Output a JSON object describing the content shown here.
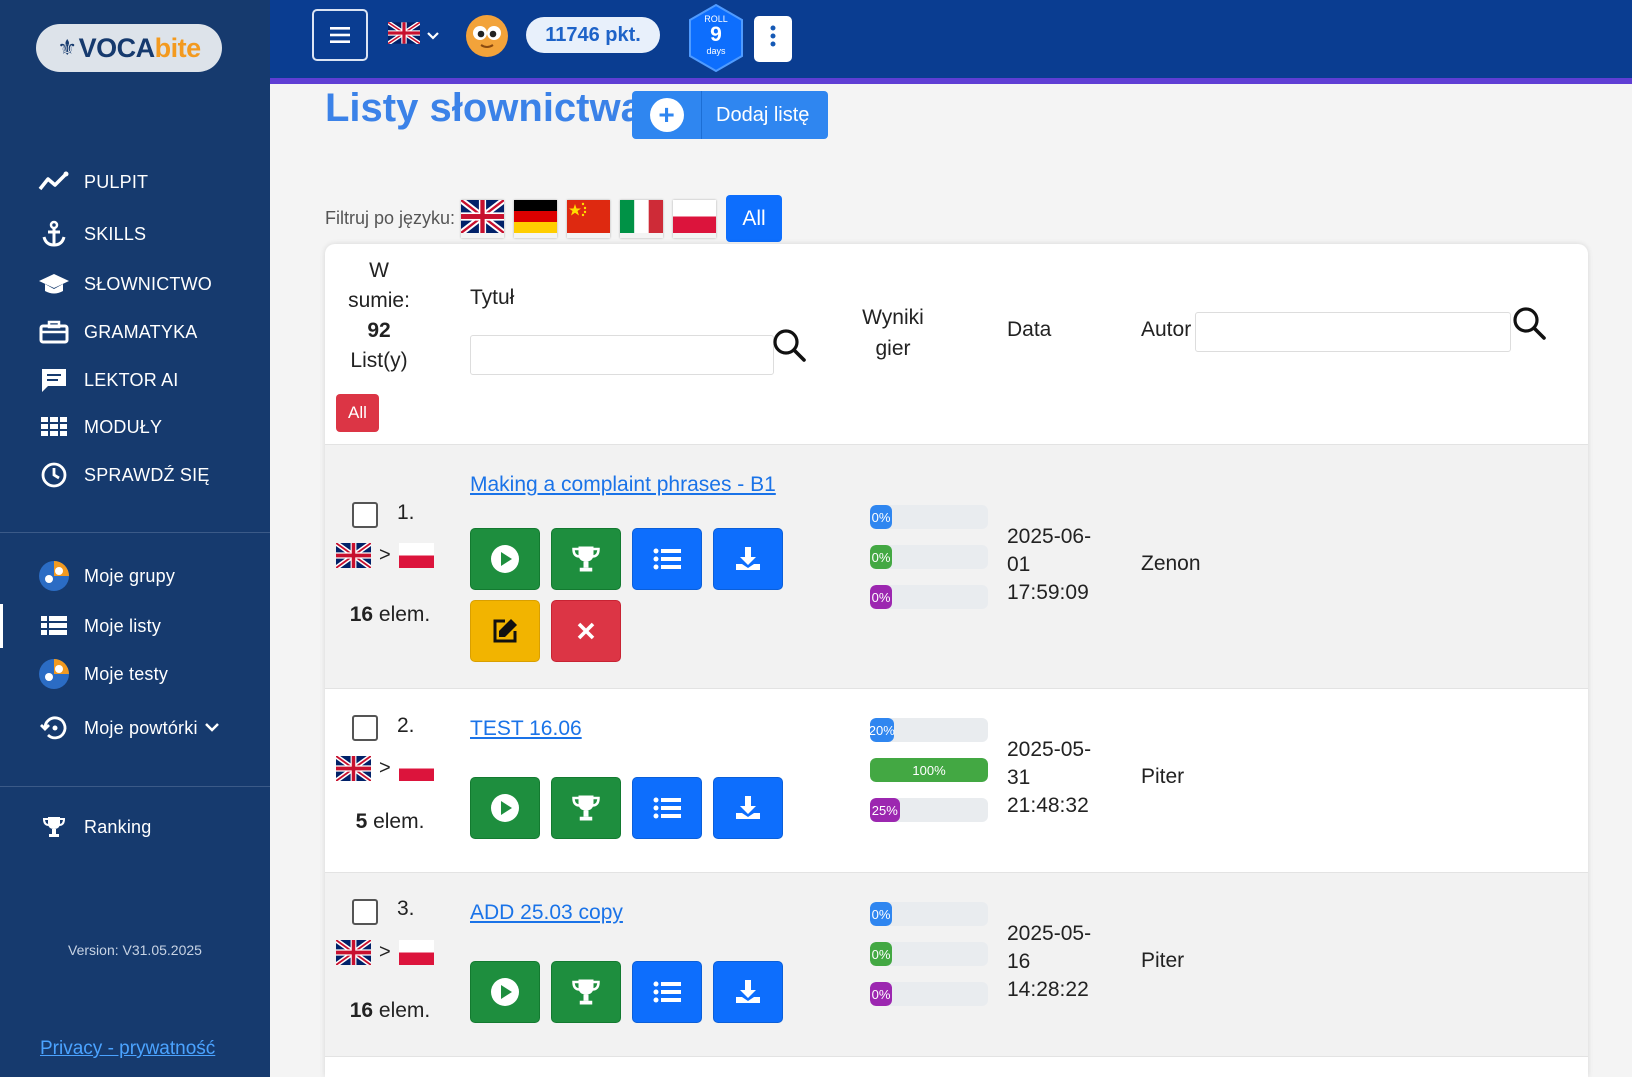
{
  "app": {
    "logo_prefix": "VOCA",
    "logo_suffix": "bite",
    "points": "11746 pkt.",
    "streak": {
      "top": "ROLL",
      "value": "9",
      "bottom": "days"
    }
  },
  "sidebar": {
    "main_items": [
      {
        "label": "PULPIT",
        "icon": "chart-line-icon"
      },
      {
        "label": "SKILLS",
        "icon": "anchor-icon"
      },
      {
        "label": "SŁOWNICTWO",
        "icon": "graduation-cap-icon"
      },
      {
        "label": "GRAMATYKA",
        "icon": "briefcase-icon"
      },
      {
        "label": "LEKTOR AI",
        "icon": "chat-icon"
      },
      {
        "label": "MODUŁY",
        "icon": "grid-icon"
      },
      {
        "label": "SPRAWDŹ SIĘ",
        "icon": "clock-icon"
      }
    ],
    "user_items": [
      {
        "label": "Moje grupy",
        "icon": "group-icon"
      },
      {
        "label": "Moje listy",
        "icon": "list-icon"
      },
      {
        "label": "Moje testy",
        "icon": "test-icon"
      },
      {
        "label": "Moje powtórki",
        "icon": "history-icon"
      }
    ],
    "ranking": "Ranking",
    "version": "Version: V31.05.2025",
    "privacy": "Privacy - prywatność"
  },
  "main": {
    "title": "Listy słownictwa",
    "add_button": "Dodaj listę",
    "filter_label": "Filtruj po języku:",
    "filter_flags": [
      "uk-flag",
      "de-flag",
      "cn-flag",
      "it-flag",
      "pl-flag"
    ],
    "filter_all": "All"
  },
  "table": {
    "total_line1": "W",
    "total_line2": "sumie:",
    "total_count": "92",
    "total_line4": "List(y)",
    "all_button": "All",
    "col_title": "Tytuł",
    "col_results_1": "Wyniki",
    "col_results_2": "gier",
    "col_date": "Data",
    "col_author": "Autor",
    "rows": [
      {
        "num": "1.",
        "elem_count": "16",
        "elem_unit": " elem.",
        "title": "Making a complaint phrases - B1",
        "results": [
          {
            "label": "0%",
            "pct": 0
          },
          {
            "label": "0%",
            "pct": 0
          },
          {
            "label": "0%",
            "pct": 0
          }
        ],
        "date_1": "2025-06-",
        "date_2": "01",
        "date_3": "17:59:09",
        "author": "Zenon"
      },
      {
        "num": "2.",
        "elem_count": "5",
        "elem_unit": " elem.",
        "title": "TEST 16.06",
        "results": [
          {
            "label": "20%",
            "pct": 20
          },
          {
            "label": "100%",
            "pct": 100
          },
          {
            "label": "25%",
            "pct": 25
          }
        ],
        "date_1": "2025-05-",
        "date_2": "31",
        "date_3": "21:48:32",
        "author": "Piter"
      },
      {
        "num": "3.",
        "elem_count": "16",
        "elem_unit": " elem.",
        "title": "ADD 25.03 copy",
        "results": [
          {
            "label": "0%",
            "pct": 0
          },
          {
            "label": "0%",
            "pct": 0
          },
          {
            "label": "0%",
            "pct": 0
          }
        ],
        "date_1": "2025-05-",
        "date_2": "16",
        "date_3": "14:28:22",
        "author": "Piter"
      }
    ]
  }
}
